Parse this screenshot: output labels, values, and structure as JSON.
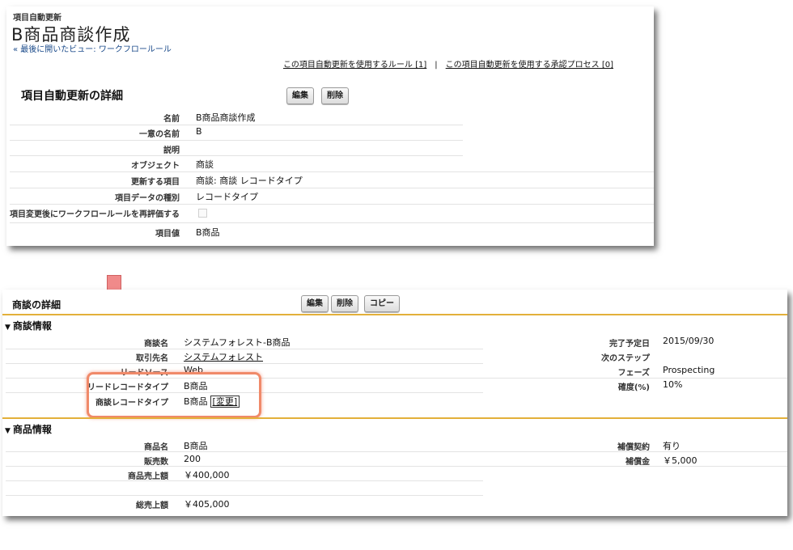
{
  "field_update": {
    "caption": "項目自動更新",
    "title": "B商品商談作成",
    "back_link": "« 最後に開いたビュー: ワークフロールール",
    "related_links": {
      "rules": "この項目自動更新を使用するルール [1]",
      "separator": "|",
      "approvals": "この項目自動更新を使用する承認プロセス [0]"
    },
    "section_heading": "項目自動更新の詳細",
    "edit_button": "編集",
    "delete_button": "削除",
    "fields": [
      {
        "label": "名前",
        "value": "B商品商談作成"
      },
      {
        "label": "一意の名前",
        "value": "B"
      },
      {
        "label": "説明",
        "value": ""
      },
      {
        "label": "オブジェクト",
        "value": "商談"
      },
      {
        "label": "更新する項目",
        "value": "商談: 商談 レコードタイプ"
      },
      {
        "label": "項目データの種別",
        "value": "レコードタイプ"
      },
      {
        "label": "項目変更後にワークフロールールを再評価する",
        "value": ""
      },
      {
        "label": "項目値",
        "value": "B商品"
      }
    ]
  },
  "opportunity": {
    "section_heading": "商談の詳細",
    "edit_button": "編集",
    "delete_button": "削除",
    "copy_button": "コピー",
    "info_section": "商談情報",
    "info_left": [
      {
        "label": "商談名",
        "value": "システムフォレスト-B商品"
      },
      {
        "label": "取引先名",
        "value": "システムフォレスト"
      },
      {
        "label": "リードソース",
        "value": "Web"
      },
      {
        "label": "リードレコードタイプ",
        "value": "B商品"
      },
      {
        "label": "商談レコードタイプ",
        "value": "B商品"
      }
    ],
    "change_link": "[変更]",
    "info_right": [
      {
        "label": "完了予定日",
        "value": "2015/09/30"
      },
      {
        "label": "次のステップ",
        "value": ""
      },
      {
        "label": "フェーズ",
        "value": "Prospecting"
      },
      {
        "label": "確度(%)",
        "value": "10%"
      }
    ],
    "product_section": "商品情報",
    "product_left": [
      {
        "label": "商品名",
        "value": "B商品"
      },
      {
        "label": "販売数",
        "value": "200"
      },
      {
        "label": "商品売上額",
        "value": "￥400,000"
      },
      {
        "label": "",
        "value": ""
      },
      {
        "label": "総売上額",
        "value": "￥405,000"
      }
    ],
    "product_right": [
      {
        "label": "補償契約",
        "value": "有り"
      },
      {
        "label": "補償金",
        "value": "￥5,000"
      }
    ],
    "colors": {
      "section_line": "#e3b03a",
      "highlight": "#f08a6a",
      "arrow": "#f08a8a"
    }
  }
}
